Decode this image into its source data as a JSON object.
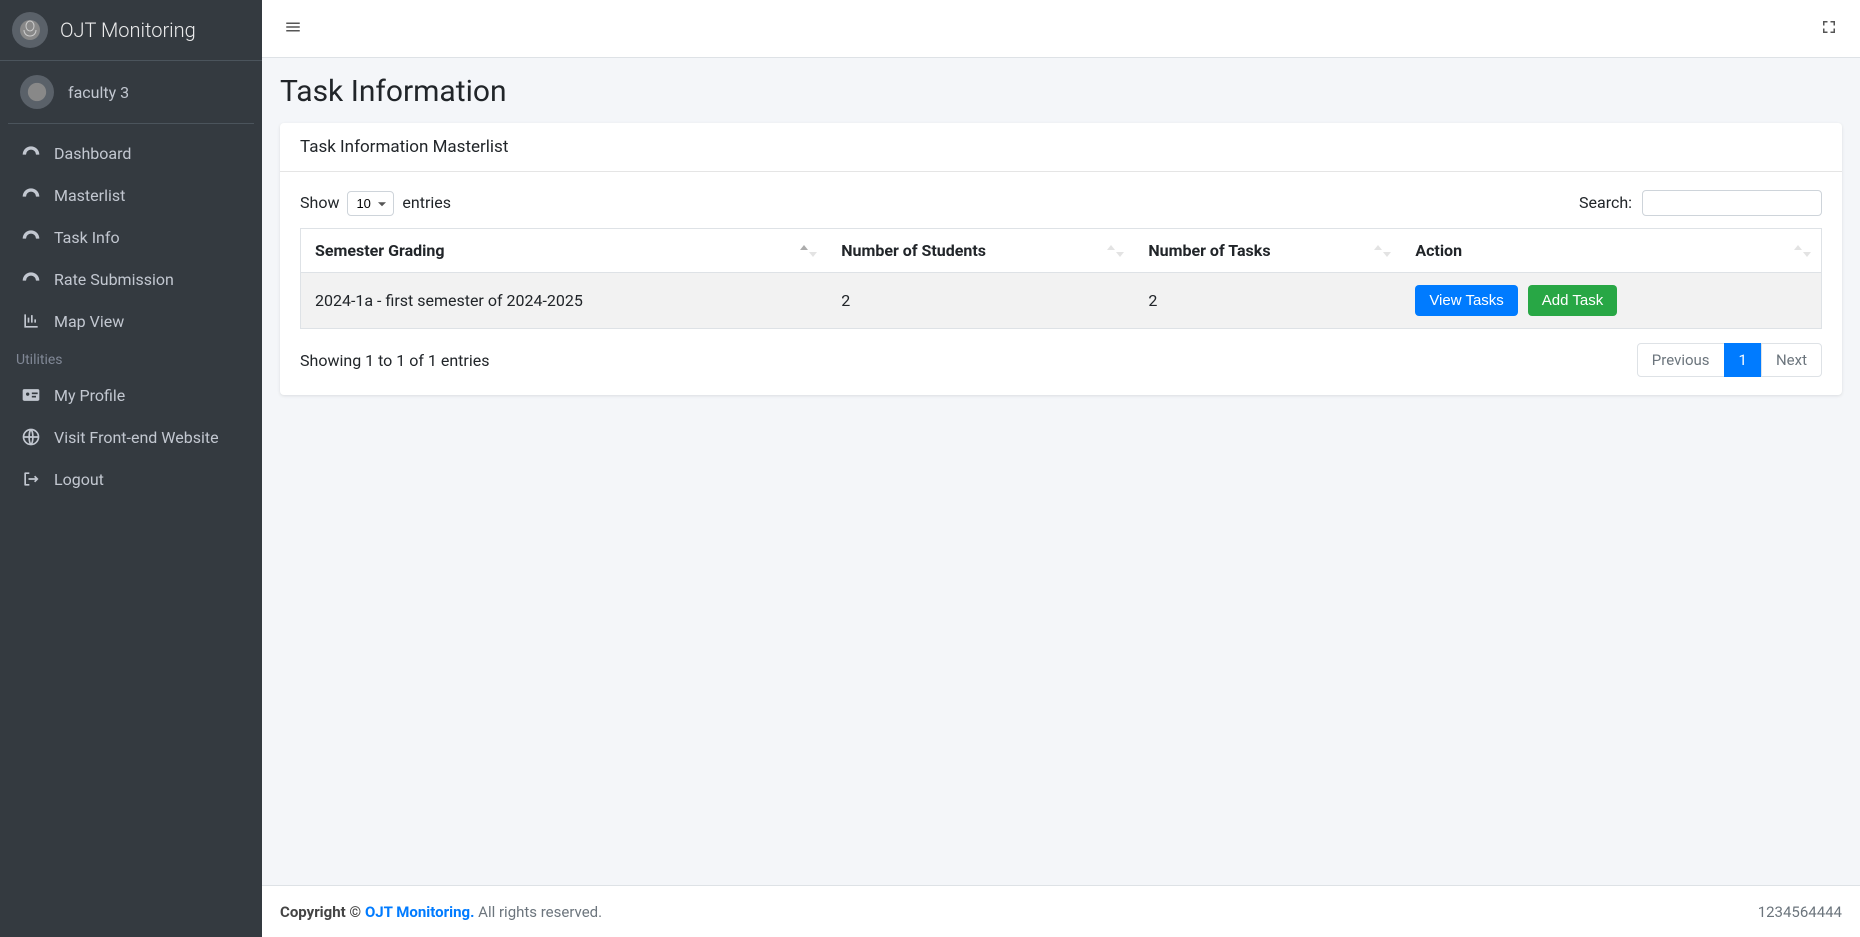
{
  "brand": {
    "title": "OJT Monitoring"
  },
  "user": {
    "name": "faculty 3"
  },
  "sidebar": {
    "main": [
      {
        "label": "Dashboard",
        "icon": "tachometer"
      },
      {
        "label": "Masterlist",
        "icon": "tachometer"
      },
      {
        "label": "Task Info",
        "icon": "tachometer"
      },
      {
        "label": "Rate Submission",
        "icon": "tachometer"
      },
      {
        "label": "Map View",
        "icon": "chart"
      }
    ],
    "utilities_header": "Utilities",
    "utilities": [
      {
        "label": "My Profile",
        "icon": "idcard"
      },
      {
        "label": "Visit Front-end Website",
        "icon": "globe"
      },
      {
        "label": "Logout",
        "icon": "signout"
      }
    ]
  },
  "page": {
    "title": "Task Information",
    "card_title": "Task Information Masterlist"
  },
  "datatable": {
    "length_prefix": "Show",
    "length_value": "10",
    "length_suffix": "entries",
    "search_label": "Search:",
    "search_value": "",
    "columns": [
      "Semester Grading",
      "Number of Students",
      "Number of Tasks",
      "Action"
    ],
    "rows": [
      {
        "semester": "2024-1a - first semester of 2024-2025",
        "students": "2",
        "tasks": "2",
        "actions": {
          "view": "View Tasks",
          "add": "Add Task"
        }
      }
    ],
    "info": "Showing 1 to 1 of 1 entries",
    "paginate": {
      "previous": "Previous",
      "page": "1",
      "next": "Next"
    }
  },
  "footer": {
    "copyright_prefix": "Copyright © ",
    "brand_link": "OJT Monitoring.",
    "copyright_suffix": " All rights reserved.",
    "right": "1234564444"
  }
}
